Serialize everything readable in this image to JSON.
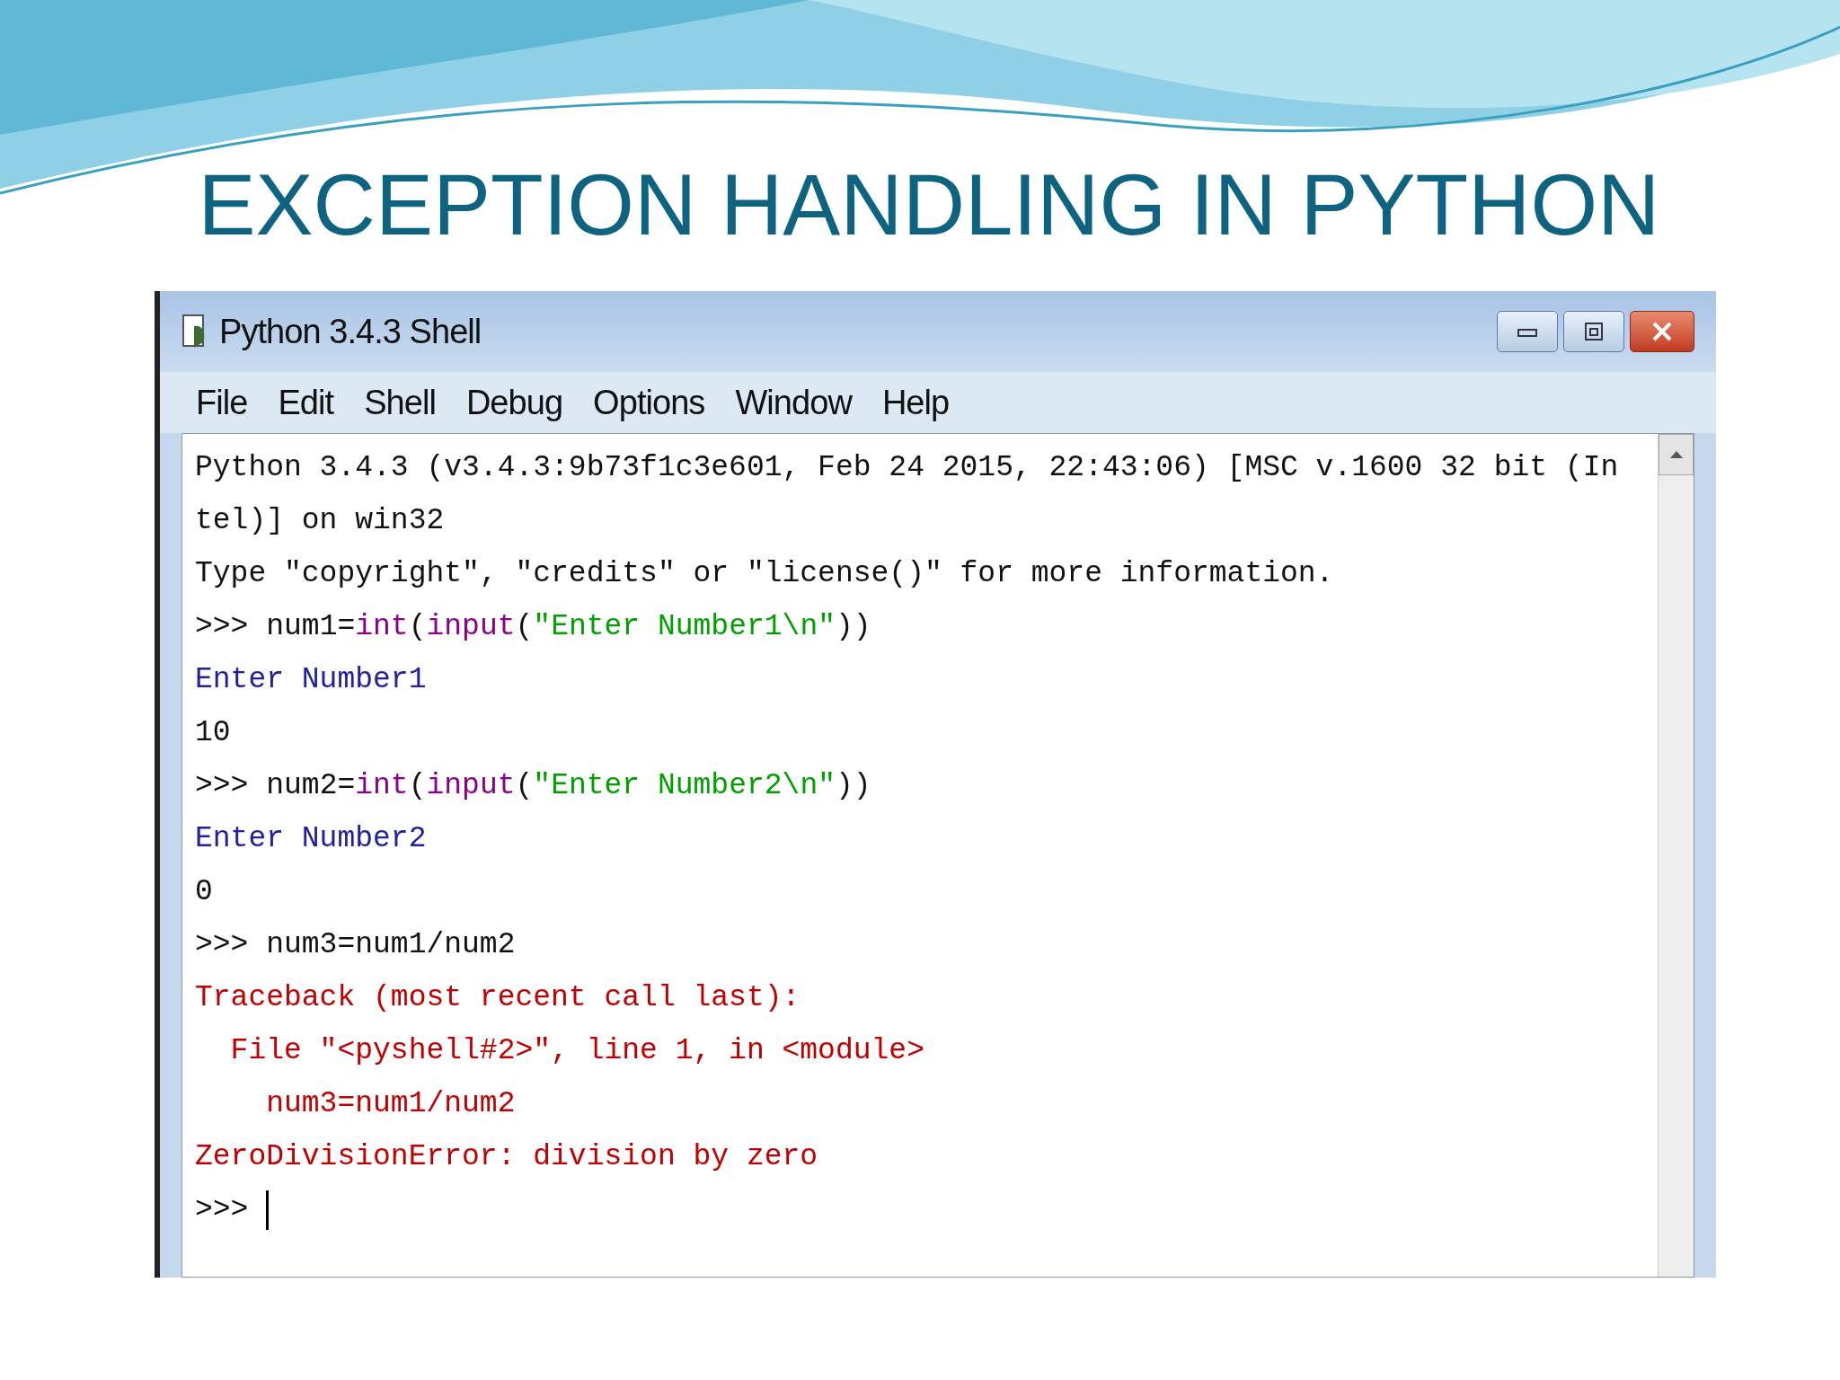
{
  "slide_title": "EXCEPTION HANDLING IN PYTHON",
  "window": {
    "title": "Python 3.4.3 Shell"
  },
  "menu": [
    "File",
    "Edit",
    "Shell",
    "Debug",
    "Options",
    "Window",
    "Help"
  ],
  "shell_lines": [
    {
      "segments": [
        {
          "text": "Python 3.4.3 (v3.4.3:9b73f1c3e601, Feb 24 2015, 22:43:06) [MSC v.1600 32 bit (In",
          "kind": "plain"
        }
      ]
    },
    {
      "segments": [
        {
          "text": "tel)] on win32",
          "kind": "plain"
        }
      ]
    },
    {
      "segments": [
        {
          "text": "Type \"copyright\", \"credits\" or \"license()\" for more information.",
          "kind": "plain"
        }
      ]
    },
    {
      "segments": [
        {
          "text": ">>> ",
          "kind": "plain"
        },
        {
          "text": "num1=",
          "kind": "plain"
        },
        {
          "text": "int",
          "kind": "builtin"
        },
        {
          "text": "(",
          "kind": "plain"
        },
        {
          "text": "input",
          "kind": "builtin"
        },
        {
          "text": "(",
          "kind": "plain"
        },
        {
          "text": "\"Enter Number1\\n\"",
          "kind": "string"
        },
        {
          "text": "))",
          "kind": "plain"
        }
      ]
    },
    {
      "segments": [
        {
          "text": "Enter Number1",
          "kind": "stdout"
        }
      ]
    },
    {
      "segments": [
        {
          "text": "10",
          "kind": "plain"
        }
      ]
    },
    {
      "segments": [
        {
          "text": ">>> ",
          "kind": "plain"
        },
        {
          "text": "num2=",
          "kind": "plain"
        },
        {
          "text": "int",
          "kind": "builtin"
        },
        {
          "text": "(",
          "kind": "plain"
        },
        {
          "text": "input",
          "kind": "builtin"
        },
        {
          "text": "(",
          "kind": "plain"
        },
        {
          "text": "\"Enter Number2\\n\"",
          "kind": "string"
        },
        {
          "text": "))",
          "kind": "plain"
        }
      ]
    },
    {
      "segments": [
        {
          "text": "Enter Number2",
          "kind": "stdout"
        }
      ]
    },
    {
      "segments": [
        {
          "text": "0",
          "kind": "plain"
        }
      ]
    },
    {
      "segments": [
        {
          "text": ">>> num3=num1/num2",
          "kind": "plain"
        }
      ]
    },
    {
      "segments": [
        {
          "text": "Traceback (most recent call last):",
          "kind": "error"
        }
      ]
    },
    {
      "segments": [
        {
          "text": "  File \"<pyshell#2>\", line 1, in <module>",
          "kind": "error"
        }
      ]
    },
    {
      "segments": [
        {
          "text": "    num3=num1/num2",
          "kind": "error"
        }
      ]
    },
    {
      "segments": [
        {
          "text": "ZeroDivisionError: division by zero",
          "kind": "error"
        }
      ]
    },
    {
      "segments": [
        {
          "text": ">>> ",
          "kind": "plain"
        }
      ],
      "cursor": true
    }
  ]
}
